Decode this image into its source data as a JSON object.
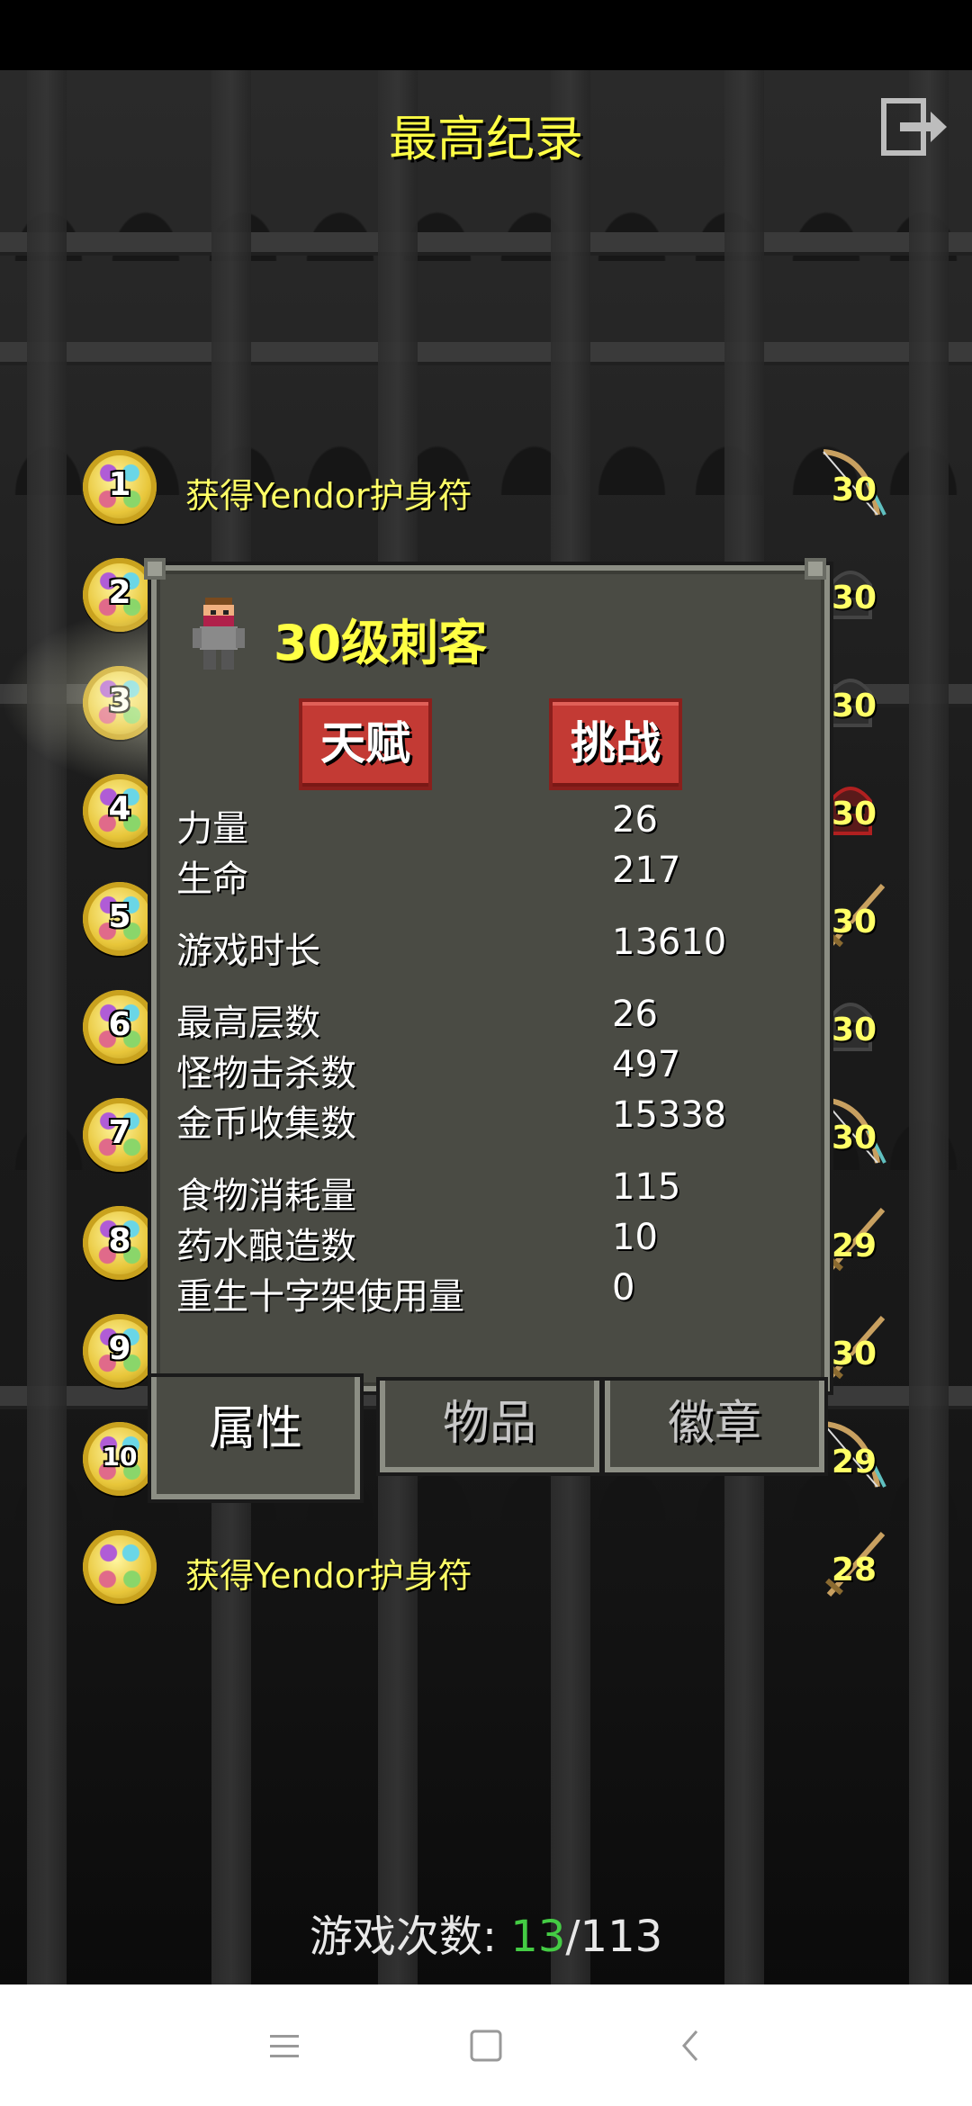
{
  "screen": {
    "title": "最高纪录",
    "exit_icon": "exit-icon"
  },
  "records": [
    {
      "rank": "1",
      "text": "获得Yendor护身符",
      "level": "30",
      "weapon": "bow"
    },
    {
      "rank": "2",
      "text": "",
      "level": "30",
      "weapon": "helmet"
    },
    {
      "rank": "3",
      "text": "",
      "level": "30",
      "weapon": "helmet"
    },
    {
      "rank": "4",
      "text": "",
      "level": "30",
      "weapon": "red-helmet"
    },
    {
      "rank": "5",
      "text": "",
      "level": "30",
      "weapon": "sword"
    },
    {
      "rank": "6",
      "text": "",
      "level": "30",
      "weapon": "helmet"
    },
    {
      "rank": "7",
      "text": "",
      "level": "30",
      "weapon": "bow"
    },
    {
      "rank": "8",
      "text": "",
      "level": "29",
      "weapon": "sword"
    },
    {
      "rank": "9",
      "text": "",
      "level": "30",
      "weapon": "sword"
    },
    {
      "rank": "10",
      "text": "",
      "level": "29",
      "weapon": "bow"
    },
    {
      "rank": "",
      "text": "获得Yendor护身符",
      "level": "28",
      "weapon": "sword"
    }
  ],
  "dialog": {
    "hero_title": "30级刺客",
    "buttons": {
      "talent": "天赋",
      "challenge": "挑战"
    },
    "stats": [
      {
        "label": "力量",
        "value": "26"
      },
      {
        "label": "生命",
        "value": "217"
      },
      {
        "label": "游戏时长",
        "value": "13610"
      },
      {
        "label": "最高层数",
        "value": "26"
      },
      {
        "label": "怪物击杀数",
        "value": "497"
      },
      {
        "label": "金币收集数",
        "value": "15338"
      },
      {
        "label": "食物消耗量",
        "value": "115"
      },
      {
        "label": "药水酿造数",
        "value": "10"
      },
      {
        "label": "重生十字架使用量",
        "value": "0"
      }
    ],
    "tabs": {
      "attributes": "属性",
      "items": "物品",
      "badges": "徽章"
    }
  },
  "footer": {
    "label": "游戏次数:",
    "current": "13",
    "sep_total": "/113"
  },
  "navbar": {
    "menu_icon": "menu-icon",
    "home_icon": "home-square-icon",
    "back_icon": "back-chevron-icon"
  },
  "colors": {
    "title": "#ffff44",
    "button_red": "#c33a34",
    "panel": "#4a4b44",
    "count_green": "#44cc44"
  }
}
